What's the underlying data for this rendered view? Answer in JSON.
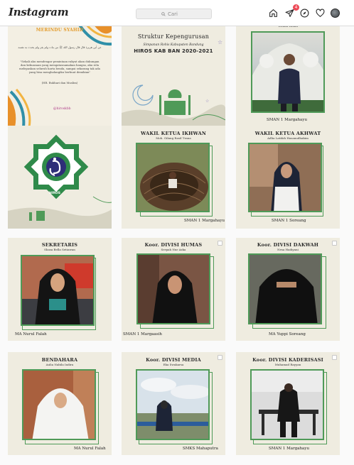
{
  "app": {
    "logo": "Instagram"
  },
  "search": {
    "placeholder": "Cari"
  },
  "nav": {
    "notification_count": "4"
  },
  "posts": [
    {
      "kind": "quote",
      "title": "MERINDU SYAHID",
      "arabic": "عن أبي هريرة قال قال رسول الله ﷺ من مات ولم يغز ولم يحدث به نفسه",
      "body": "\"Sekali aku mendengar pemintaan rakyat akan dukungan dan kekuasaan yang mengatasnamakan bangsa, aku rela melepaskan seluruh harta benda, sampai sekarang tak ada yang bisa menghalangiku berbuat demikian\"",
      "source": "(HR. Bukhari dan Muslim)",
      "handle": "@hiroskbb"
    },
    {
      "kind": "structure",
      "title": "Struktur Kepengurusan",
      "subtitle": "Simpanan Rohis Kabupaten Bandung",
      "headline": "HIROS KAB BAN 2020-2021"
    },
    {
      "kind": "member",
      "role": "",
      "name": "Wildan Ismail",
      "school": "SMAN 1 Margahayu"
    },
    {
      "kind": "logo",
      "label": "HIROS"
    },
    {
      "kind": "member",
      "role": "WAKIL KETUA IKHWAN",
      "name": "Moh. Gilang Rasil Trana",
      "school": "SMAN 1 Margahayu"
    },
    {
      "kind": "member",
      "role": "WAKIL KETUA AKHWAT",
      "name": "Adlia Latifah Hasanudhakim",
      "school": "SMAN 1 Soreang"
    },
    {
      "kind": "member",
      "role": "SEKRETARIS",
      "name": "Shasa Bella Setiawan",
      "school": "MA Nurul Falah"
    },
    {
      "kind": "member",
      "role": "Koor. DIVISI HUMAS",
      "name": "Serpah Nur Azka",
      "school": "SMAN 1 Margaasih"
    },
    {
      "kind": "member",
      "role": "Koor. DIVISI DAKWAH",
      "name": "Nesa Hadiyani",
      "school": "MA Yuppi Soreang"
    },
    {
      "kind": "member",
      "role": "BENDAHARA",
      "name": "Aulia Nabila Indira",
      "school": "MA Nurul Falah"
    },
    {
      "kind": "member",
      "role": "Koor. DIVISI MEDIA",
      "name": "Eka Swakarsa",
      "school": "SMKS Mahaputra"
    },
    {
      "kind": "member",
      "role": "Koor. DIVISI KADERISASI",
      "name": "Muhamad Rayyan",
      "school": "SMAN 1 Margahayu"
    }
  ],
  "colors": {
    "accent_green": "#4f9a58",
    "tile_bg": "#efece0",
    "badge_red": "#ed4956"
  }
}
